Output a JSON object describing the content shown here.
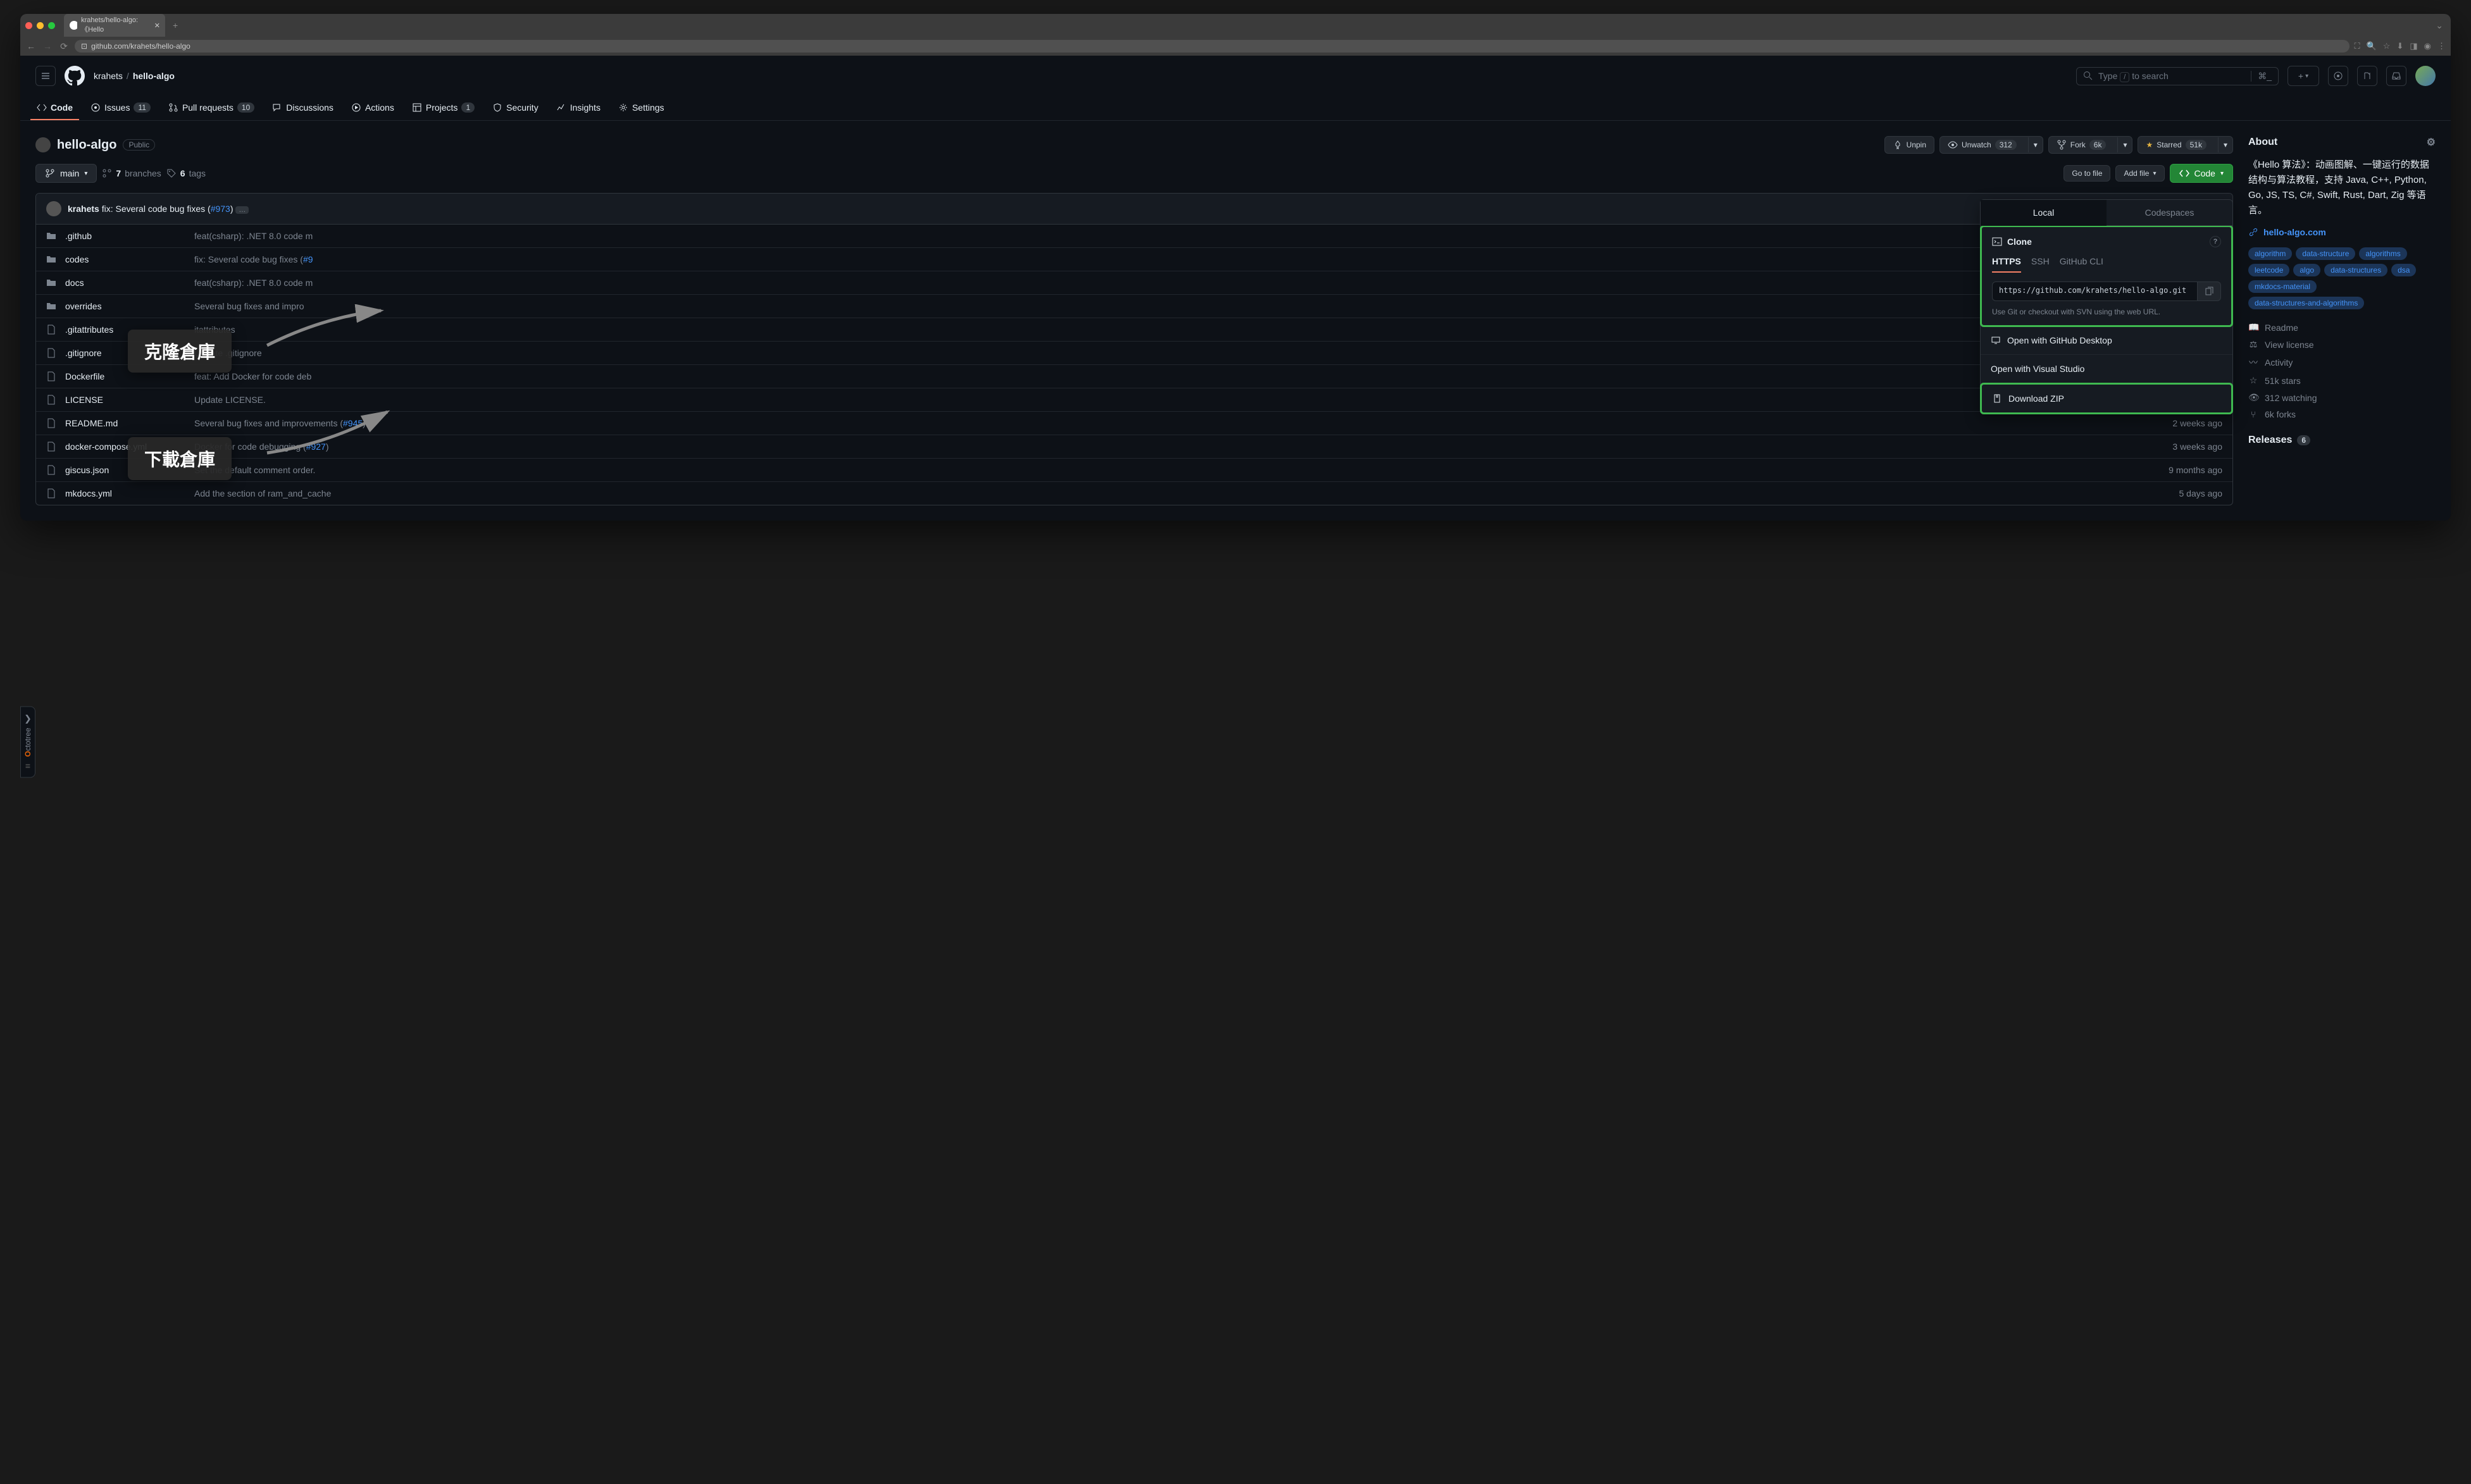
{
  "browser": {
    "tab_title": "krahets/hello-algo: 《Hello",
    "url": "github.com/krahets/hello-algo"
  },
  "header": {
    "owner": "krahets",
    "repo": "hello-algo",
    "search_placeholder": "Type / to search"
  },
  "nav": {
    "code": "Code",
    "issues": "Issues",
    "issues_count": "11",
    "pulls": "Pull requests",
    "pulls_count": "10",
    "discussions": "Discussions",
    "actions": "Actions",
    "projects": "Projects",
    "projects_count": "1",
    "security": "Security",
    "insights": "Insights",
    "settings": "Settings"
  },
  "repo": {
    "name": "hello-algo",
    "visibility": "Public",
    "unpin": "Unpin",
    "unwatch": "Unwatch",
    "watch_count": "312",
    "fork": "Fork",
    "fork_count": "6k",
    "starred": "Starred",
    "star_count": "51k"
  },
  "toolbar": {
    "branch": "main",
    "branches_n": "7",
    "branches": "branches",
    "tags_n": "6",
    "tags": "tags",
    "go_to_file": "Go to file",
    "add_file": "Add file",
    "code_btn": "Code"
  },
  "commit": {
    "author": "krahets",
    "msg": "fix: Several code bug fixes (",
    "pr": "#973",
    "close": ")"
  },
  "files": [
    {
      "icon": "dir",
      "name": ".github",
      "msg": "feat(csharp): .NET 8.0 code m",
      "time": ""
    },
    {
      "icon": "dir",
      "name": "codes",
      "msg": "fix: Several code bug fixes (",
      "pr": "#9",
      "time": ""
    },
    {
      "icon": "dir",
      "name": "docs",
      "msg": "feat(csharp): .NET 8.0 code m",
      "time": ""
    },
    {
      "icon": "dir",
      "name": "overrides",
      "msg": "Several bug fixes and impro",
      "time": ""
    },
    {
      "icon": "file",
      "name": ".gitattributes",
      "msg": "itattributes",
      "time": ""
    },
    {
      "icon": "file",
      "name": ".gitignore",
      "msg": "Update .gitignore",
      "time": ""
    },
    {
      "icon": "file",
      "name": "Dockerfile",
      "msg": "feat: Add Docker for code deb",
      "time": ""
    },
    {
      "icon": "file",
      "name": "LICENSE",
      "msg": "Update LICENSE.",
      "time": ""
    },
    {
      "icon": "file",
      "name": "README.md",
      "msg": "Several bug fixes and improvements (",
      "pr": "#945",
      "suf": ")",
      "time": "2 weeks ago"
    },
    {
      "icon": "file",
      "name": "docker-compose.yml",
      "msg": "Docker for code debugging (",
      "pr": "#927",
      "suf": ")",
      "time": "3 weeks ago"
    },
    {
      "icon": "file",
      "name": "giscus.json",
      "msg": "Set the default comment order.",
      "time": "9 months ago"
    },
    {
      "icon": "file",
      "name": "mkdocs.yml",
      "msg": "Add the section of ram_and_cache",
      "time": "5 days ago"
    }
  ],
  "dropdown": {
    "local": "Local",
    "codespaces": "Codespaces",
    "clone": "Clone",
    "https": "HTTPS",
    "ssh": "SSH",
    "cli": "GitHub CLI",
    "url": "https://github.com/krahets/hello-algo.git",
    "hint": "Use Git or checkout with SVN using the web URL.",
    "gh_desktop": "Open with GitHub Desktop",
    "vs": "Open with Visual Studio",
    "zip": "Download ZIP"
  },
  "about": {
    "title": "About",
    "desc": "《Hello 算法》：动画图解、一键运行的数据结构与算法教程，支持 Java, C++, Python, Go, JS, TS, C#, Swift, Rust, Dart, Zig 等语言。",
    "website": "hello-algo.com",
    "topics": [
      "algorithm",
      "data-structure",
      "algorithms",
      "leetcode",
      "algo",
      "data-structures",
      "dsa",
      "mkdocs-material",
      "data-structures-and-algorithms"
    ],
    "readme": "Readme",
    "license": "View license",
    "activity": "Activity",
    "stars": "51k stars",
    "watching": "312 watching",
    "forks": "6k forks",
    "releases": "Releases",
    "releases_count": "6"
  },
  "annotations": {
    "clone": "克隆倉庫",
    "download": "下載倉庫"
  },
  "octotree": "Octotree"
}
